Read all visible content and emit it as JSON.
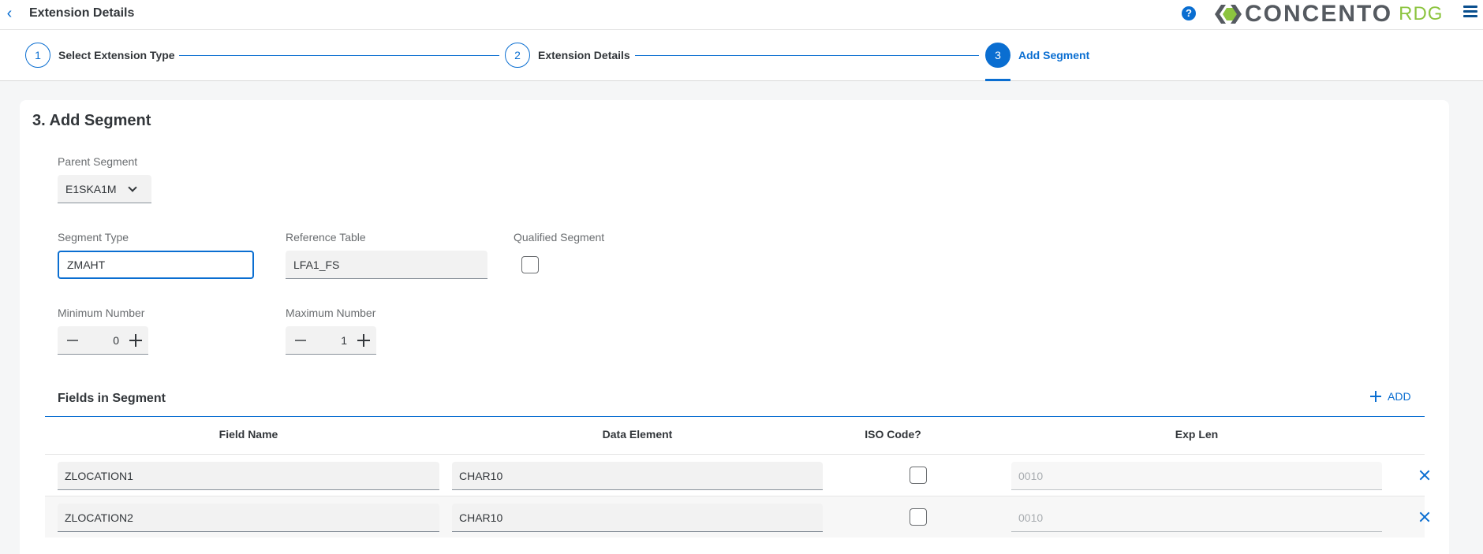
{
  "header": {
    "title": "Extension Details",
    "help_glyph": "?",
    "logo_word": "CONCENTO",
    "logo_suffix": "RDG"
  },
  "wizard": {
    "steps": [
      {
        "number": "1",
        "label": "Select Extension Type"
      },
      {
        "number": "2",
        "label": "Extension Details"
      },
      {
        "number": "3",
        "label": "Add Segment"
      }
    ]
  },
  "form": {
    "section_title": "3. Add Segment",
    "parent_segment": {
      "label": "Parent Segment",
      "value": "E1SKA1M"
    },
    "segment_type": {
      "label": "Segment Type",
      "value": "ZMAHT"
    },
    "reference_table": {
      "label": "Reference Table",
      "value": "LFA1_FS"
    },
    "qualified_segment": {
      "label": "Qualified Segment",
      "checked": false
    },
    "minimum_number": {
      "label": "Minimum Number",
      "value": "0"
    },
    "maximum_number": {
      "label": "Maximum Number",
      "value": "1"
    }
  },
  "fields": {
    "title": "Fields in Segment",
    "add_label": "ADD",
    "columns": [
      "Field Name",
      "Data Element",
      "ISO Code?",
      "Exp Len"
    ],
    "rows": [
      {
        "field_name": "ZLOCATION1",
        "data_element": "CHAR10",
        "iso_code": false,
        "exp_len_placeholder": "0010"
      },
      {
        "field_name": "ZLOCATION2",
        "data_element": "CHAR10",
        "iso_code": false,
        "exp_len_placeholder": "0010"
      }
    ]
  },
  "colors": {
    "accent": "#0a6ed1",
    "logo_green": "#8cc43f",
    "logo_gray": "#555a60"
  }
}
